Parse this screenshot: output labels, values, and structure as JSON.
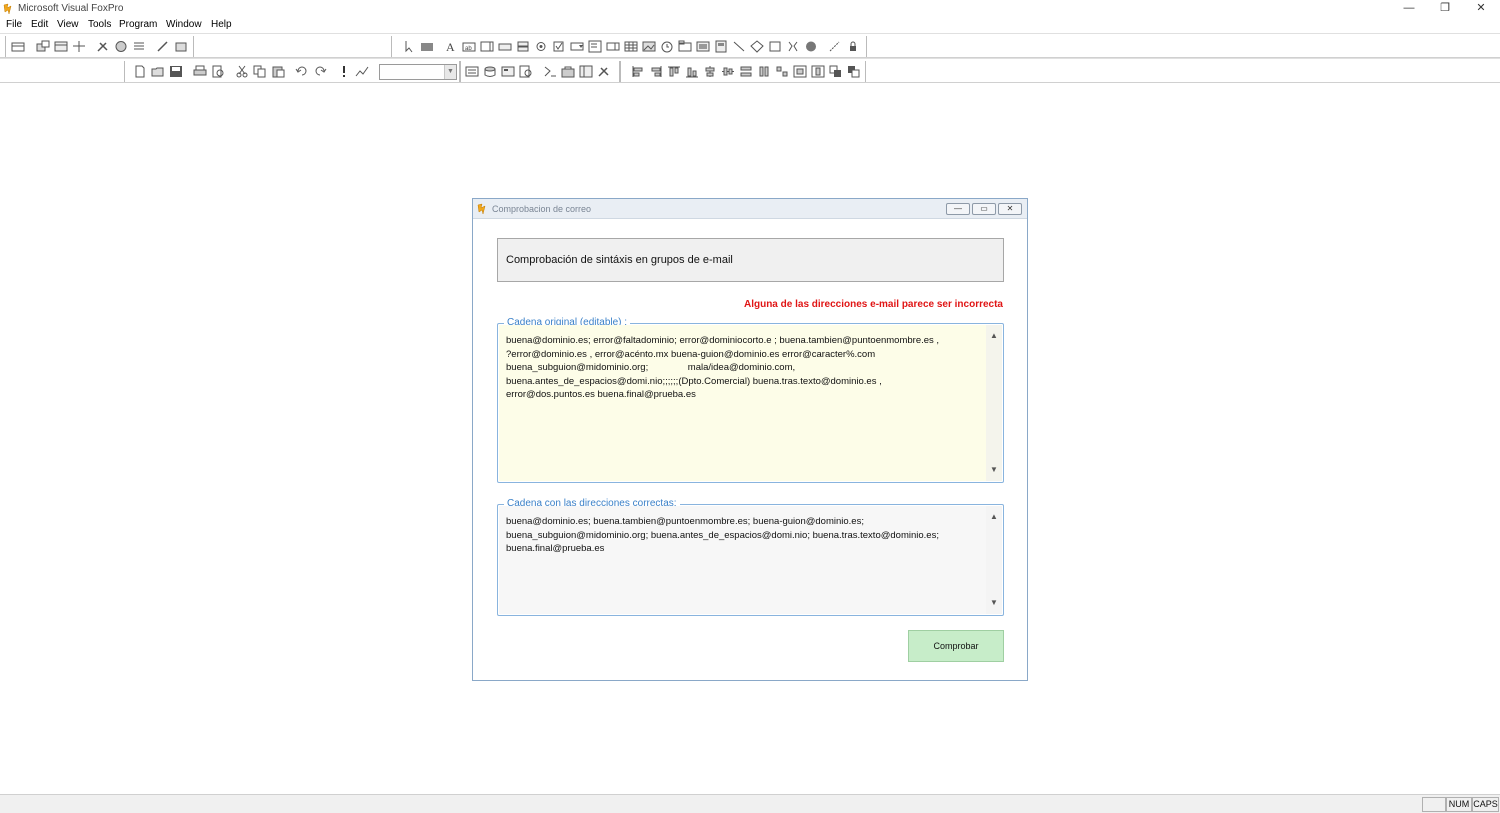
{
  "app": {
    "title": "Microsoft Visual FoxPro",
    "window_controls": [
      "—",
      "❐",
      "✕"
    ]
  },
  "menu": [
    "File",
    "Edit",
    "View",
    "Tools",
    "Program",
    "Window",
    "Help"
  ],
  "toolbar": {
    "combo_value": ""
  },
  "dialog": {
    "title": "Comprobacion de correo",
    "controls": [
      "—",
      "▭",
      "✕"
    ],
    "header": "Comprobación de sintáxis en grupos de e-mail",
    "warning": "Alguna de las direcciones e-mail parece ser incorrecta",
    "original": {
      "label": "Cadena original (editable) :",
      "text": "buena@dominio.es; error@faltadominio; error@dominiocorto.e ; buena.tambien@puntoenmombre.es ,\n?error@dominio.es , error@acénto.mx buena-guion@dominio.es error@caracter%.com\nbuena_subguion@midominio.org;               mala/idea@dominio.com,\nbuena.antes_de_espacios@domi.nio;;;;;;(Dpto.Comercial) buena.tras.texto@dominio.es ,\nerror@dos.puntos.es buena.final@prueba.es"
    },
    "correct": {
      "label": "Cadena con las direcciones correctas:",
      "text": "buena@dominio.es; buena.tambien@puntoenmombre.es; buena-guion@dominio.es;\nbuena_subguion@midominio.org; buena.antes_de_espacios@domi.nio; buena.tras.texto@dominio.es;\nbuena.final@prueba.es"
    },
    "button": "Comprobar"
  },
  "statusbar": {
    "num": "NUM",
    "caps": "CAPS"
  },
  "colors": {
    "warning": "#e01515",
    "label_blue": "#3a80c8",
    "original_bg": "#fdfde8",
    "correct_bg": "#f7f7f7",
    "button_green": "#c7edc9"
  }
}
